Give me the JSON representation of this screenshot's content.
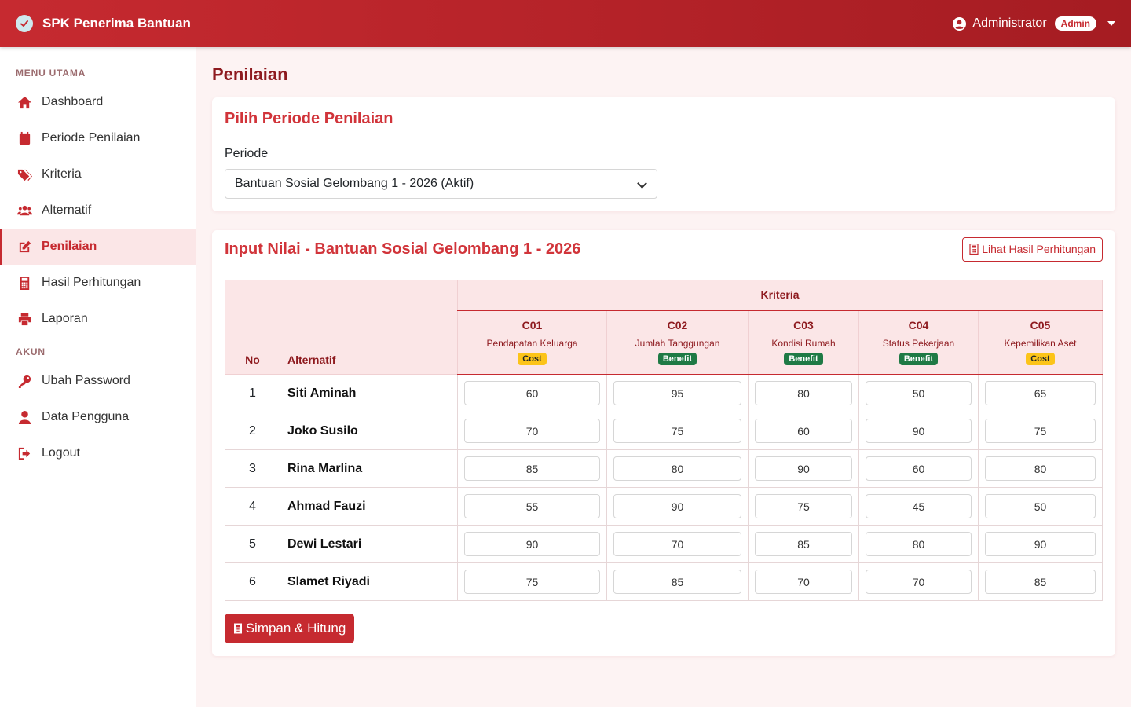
{
  "navbar": {
    "brand": "SPK Penerima Bantuan",
    "user_name": "Administrator",
    "role": "Admin"
  },
  "sidebar": {
    "section_main": "MENU UTAMA",
    "items": [
      {
        "label": "Dashboard",
        "icon": "home-icon"
      },
      {
        "label": "Periode Penilaian",
        "icon": "calendar-icon"
      },
      {
        "label": "Kriteria",
        "icon": "tags-icon"
      },
      {
        "label": "Alternatif",
        "icon": "users-icon"
      },
      {
        "label": "Penilaian",
        "icon": "edit-icon",
        "active": true
      },
      {
        "label": "Hasil Perhitungan",
        "icon": "calculator-icon"
      },
      {
        "label": "Laporan",
        "icon": "printer-icon"
      }
    ],
    "section_account": "AKUN",
    "account_items": [
      {
        "label": "Ubah Password",
        "icon": "key-icon"
      },
      {
        "label": "Data Pengguna",
        "icon": "user-icon"
      },
      {
        "label": "Logout",
        "icon": "logout-icon"
      }
    ]
  },
  "page": {
    "title": "Penilaian"
  },
  "period_card": {
    "title": "Pilih Periode Penilaian",
    "label": "Periode",
    "selected": "Bantuan Sosial Gelombang 1 - 2026 (Aktif)"
  },
  "input_card": {
    "title": "Input Nilai - Bantuan Sosial Gelombang 1 - 2026",
    "view_result_button": "Lihat Hasil Perhitungan",
    "submit_button": "Simpan & Hitung"
  },
  "table": {
    "col_no": "No",
    "col_alt": "Alternatif",
    "group_header": "Kriteria",
    "criteria": [
      {
        "code": "C01",
        "name": "Pendapatan Keluarga",
        "type": "Cost"
      },
      {
        "code": "C02",
        "name": "Jumlah Tanggungan",
        "type": "Benefit"
      },
      {
        "code": "C03",
        "name": "Kondisi Rumah",
        "type": "Benefit"
      },
      {
        "code": "C04",
        "name": "Status Pekerjaan",
        "type": "Benefit"
      },
      {
        "code": "C05",
        "name": "Kepemilikan Aset",
        "type": "Cost"
      }
    ],
    "rows": [
      {
        "no": "1",
        "name": "Siti Aminah",
        "values": [
          "60",
          "95",
          "80",
          "50",
          "65"
        ]
      },
      {
        "no": "2",
        "name": "Joko Susilo",
        "values": [
          "70",
          "75",
          "60",
          "90",
          "75"
        ]
      },
      {
        "no": "3",
        "name": "Rina Marlina",
        "values": [
          "85",
          "80",
          "90",
          "60",
          "80"
        ]
      },
      {
        "no": "4",
        "name": "Ahmad Fauzi",
        "values": [
          "55",
          "90",
          "75",
          "45",
          "50"
        ]
      },
      {
        "no": "5",
        "name": "Dewi Lestari",
        "values": [
          "90",
          "70",
          "85",
          "80",
          "90"
        ]
      },
      {
        "no": "6",
        "name": "Slamet Riyadi",
        "values": [
          "75",
          "85",
          "70",
          "70",
          "85"
        ]
      }
    ]
  },
  "colors": {
    "primary": "#c62a30",
    "dark": "#8e1a1f",
    "cost_badge": "#fcc419",
    "benefit_badge": "#1f7a45"
  }
}
